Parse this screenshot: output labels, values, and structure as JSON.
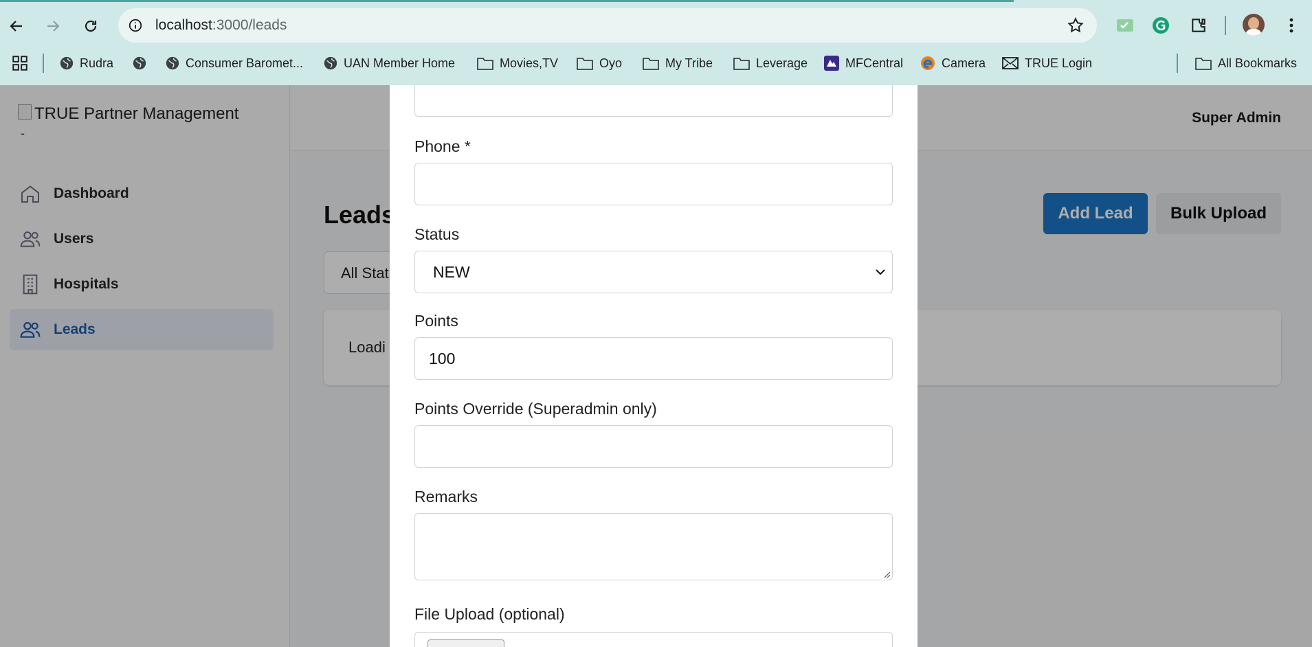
{
  "browser": {
    "url_host": "localhost",
    "url_path": ":3000/leads",
    "bookmarks": [
      {
        "label": "Rudra",
        "icon": "globe-icon"
      },
      {
        "label": "",
        "icon": "globe-icon"
      },
      {
        "label": "Consumer Baromet...",
        "icon": "globe-icon"
      },
      {
        "label": "UAN Member Home",
        "icon": "globe-icon"
      },
      {
        "label": "Movies,TV",
        "icon": "folder-icon"
      },
      {
        "label": "Oyo",
        "icon": "folder-icon"
      },
      {
        "label": "My Tribe",
        "icon": "folder-icon"
      },
      {
        "label": "Leverage",
        "icon": "folder-icon"
      },
      {
        "label": "MFCentral",
        "icon": "mfcentral-icon"
      },
      {
        "label": "Camera",
        "icon": "edge-icon"
      },
      {
        "label": "TRUE Login",
        "icon": "mail-icon"
      }
    ],
    "all_bookmarks": "All Bookmarks"
  },
  "app": {
    "logo_alt": "TRUE Partner Management",
    "logo_dash": "-",
    "sidebar": [
      {
        "label": "Dashboard",
        "icon": "home-icon"
      },
      {
        "label": "Users",
        "icon": "users-icon"
      },
      {
        "label": "Hospitals",
        "icon": "building-icon"
      },
      {
        "label": "Leads",
        "icon": "users-icon",
        "active": true
      }
    ],
    "user_name": "Super Admin",
    "page_title": "Leads",
    "add_lead": "Add Lead",
    "bulk_upload": "Bulk Upload",
    "filter_value": "All Stat",
    "loading_text": "Loadi"
  },
  "modal": {
    "phone_label": "Phone *",
    "phone_value": "",
    "status_label": "Status",
    "status_value": "NEW",
    "points_label": "Points",
    "points_value": "100",
    "points_override_label": "Points Override (Superadmin only)",
    "points_override_value": "",
    "remarks_label": "Remarks",
    "file_label": "File Upload (optional)"
  },
  "colors": {
    "chrome_bg": "#cfe9e8",
    "accent": "#1d76c8",
    "active_nav": "#1f5fa8"
  }
}
